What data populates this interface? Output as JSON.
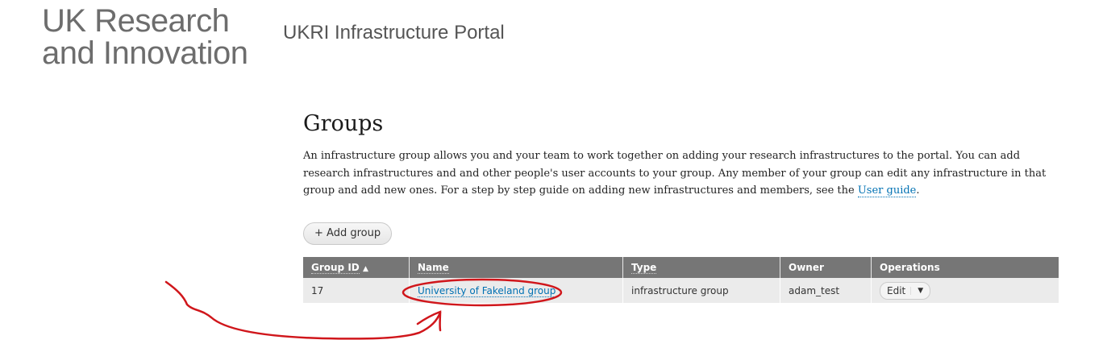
{
  "header": {
    "logo_line1": "UK Research",
    "logo_line2": "and Innovation",
    "site_name": "UKRI Infrastructure Portal"
  },
  "main": {
    "title": "Groups",
    "intro_text": "An infrastructure group allows you and your team to work together on adding your research infrastructures to the portal. You can add research infrastructures and and other people's user accounts to your group. Any member of your group can edit any infrastructure in that group and add new ones. For a step by step guide on adding new infrastructures and members, see the ",
    "intro_link": "User guide",
    "intro_end": ".",
    "add_button": "+ Add group"
  },
  "table": {
    "headers": {
      "group_id": "Group ID",
      "sort_icon": "▲",
      "name": "Name",
      "type": "Type",
      "owner": "Owner",
      "operations": "Operations"
    },
    "rows": [
      {
        "group_id": "17",
        "name": "University of Fakeland group",
        "type": "infrastructure group",
        "owner": "adam_test",
        "operation_label": "Edit",
        "dropdown_icon": "▼"
      }
    ]
  },
  "colors": {
    "link": "#0071b3",
    "table_header_bg": "#767676",
    "row_bg": "#ebebeb",
    "annotation": "#d0161b"
  }
}
